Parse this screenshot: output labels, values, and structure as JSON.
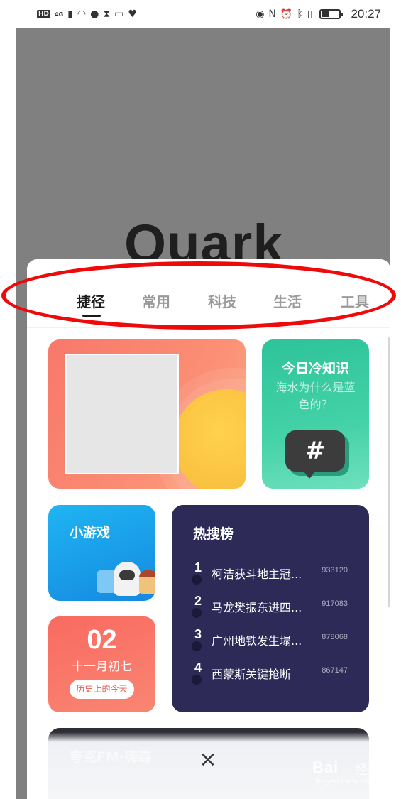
{
  "status_bar": {
    "hd_badge": "HD",
    "network": "4G",
    "time": "20:27",
    "battery_level": 0.45,
    "left_icons": [
      "signal-icon",
      "wifi-icon",
      "globe-icon",
      "hourglass-icon",
      "card-icon",
      "heart-icon"
    ],
    "right_icons": [
      "eye-icon",
      "nfc-icon",
      "alarm-icon",
      "bluetooth-icon",
      "vibrate-icon",
      "battery-icon"
    ]
  },
  "backdrop": {
    "logo_text": "Quark"
  },
  "tabs": [
    {
      "label": "捷径",
      "active": true
    },
    {
      "label": "常用",
      "active": false
    },
    {
      "label": "科技",
      "active": false
    },
    {
      "label": "生活",
      "active": false
    },
    {
      "label": "工具",
      "active": false
    }
  ],
  "cards": {
    "fact": {
      "title": "今日冷知识",
      "question": "海水为什么是蓝色的？",
      "icon": "#"
    },
    "game": {
      "title": "小游戏"
    },
    "date": {
      "day": "02",
      "lunar": "十一月初七",
      "history_label": "历史上的今天"
    },
    "hot": {
      "title": "热搜榜",
      "items": [
        {
          "rank": "1",
          "text": "柯洁获斗地主冠...",
          "count": "933120"
        },
        {
          "rank": "2",
          "text": "马龙樊振东进四...",
          "count": "917083"
        },
        {
          "rank": "3",
          "text": "广州地铁发生塌...",
          "count": "878068"
        },
        {
          "rank": "4",
          "text": "西蒙斯关键抢断",
          "count": "867147"
        }
      ]
    },
    "fm": {
      "title": "夸克FM·嗨森"
    }
  },
  "close_symbol": "×",
  "annotation_color": "#ee0a0a",
  "watermark": {
    "brand": "Bai",
    "brand_cn": "经验",
    "url": "jingyan.baidu.com"
  }
}
